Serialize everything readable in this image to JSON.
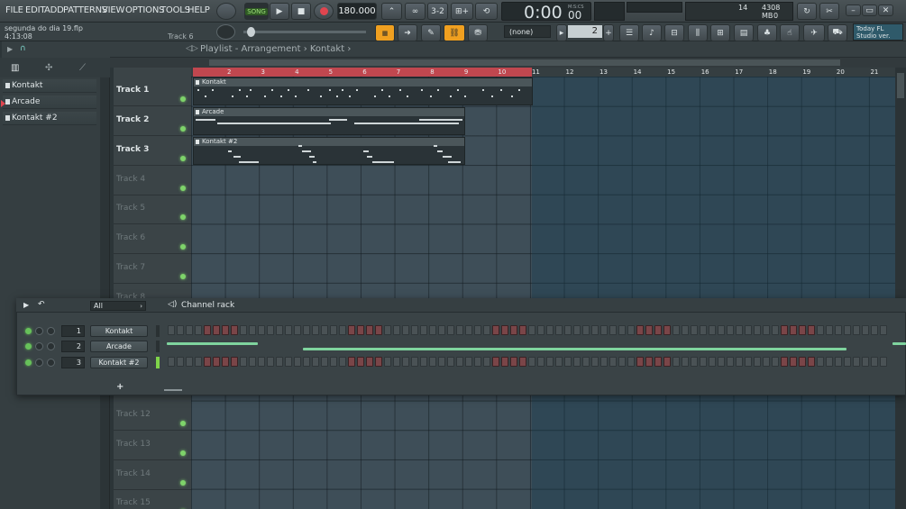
{
  "menu": [
    "FILE",
    "EDIT",
    "ADD",
    "PATTERNS",
    "VIEW",
    "OPTIONS",
    "TOOLS",
    "HELP"
  ],
  "transport": {
    "mode": "SONG",
    "tempo": "180.000",
    "time": "0:00",
    "time_fraction": "00",
    "time_label": "M:S:CS"
  },
  "monitor": {
    "value1": "14",
    "memory": "4308 MB",
    "value2": "0"
  },
  "news": {
    "line1": "Today  FL",
    "line2": "Studio ver."
  },
  "project": {
    "file": "segunda do dia 19.flp",
    "time": "4:13:08",
    "hint": "Track 6"
  },
  "pattern_select": "(none)",
  "pattern_number": "2",
  "playlist": {
    "breadcrumb": "Playlist - Arrangement › Kontakt ›",
    "bars": [
      "2",
      "3",
      "4",
      "5",
      "6",
      "7",
      "8",
      "9",
      "10",
      "11",
      "12",
      "13",
      "14",
      "15",
      "16",
      "17",
      "18",
      "19",
      "20",
      "21"
    ],
    "tracks": [
      "Track 1",
      "Track 2",
      "Track 3",
      "Track 4",
      "Track 5",
      "Track 6",
      "Track 7",
      "Track 8",
      "Track 12",
      "Track 13",
      "Track 14",
      "Track 15"
    ],
    "clips": [
      {
        "name": "Kontakt"
      },
      {
        "name": "Arcade"
      },
      {
        "name": "Kontakt #2"
      }
    ]
  },
  "browser": {
    "items": [
      "Kontakt",
      "Arcade",
      "Kontakt #2"
    ]
  },
  "channel_rack": {
    "title": "Channel rack",
    "filter": "All",
    "channels": [
      {
        "num": "1",
        "name": "Kontakt"
      },
      {
        "num": "2",
        "name": "Arcade"
      },
      {
        "num": "3",
        "name": "Kontakt #2"
      }
    ],
    "add_label": "+"
  },
  "colors": {
    "accent_orange": "#f0a020",
    "led_green": "#7ed36a",
    "loop_red": "#c0474f",
    "grid": "#3e4e58"
  }
}
